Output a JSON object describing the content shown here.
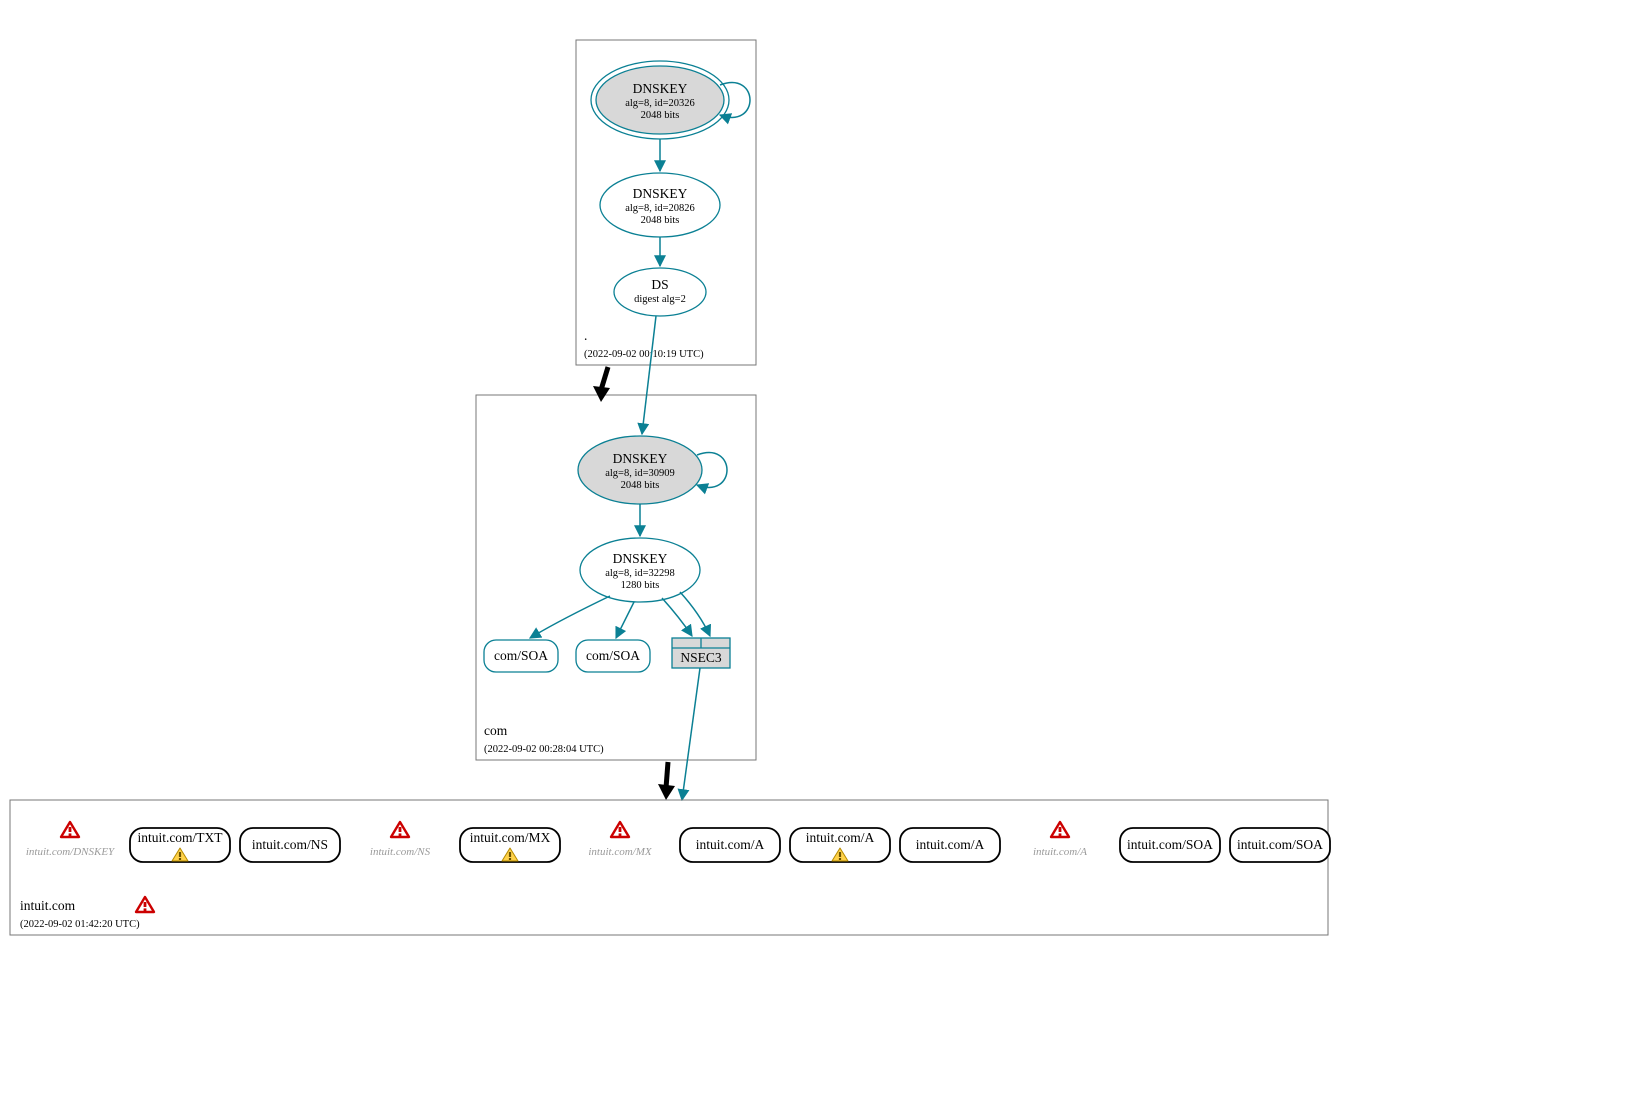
{
  "zones": {
    "root": {
      "label": ".",
      "timestamp": "(2022-09-02 00:10:19 UTC)"
    },
    "com": {
      "label": "com",
      "timestamp": "(2022-09-02 00:28:04 UTC)"
    },
    "intuit": {
      "label": "intuit.com",
      "timestamp": "(2022-09-02 01:42:20 UTC)"
    }
  },
  "nodes": {
    "root_ksk": {
      "title": "DNSKEY",
      "l2": "alg=8, id=20326",
      "l3": "2048 bits"
    },
    "root_zsk": {
      "title": "DNSKEY",
      "l2": "alg=8, id=20826",
      "l3": "2048 bits"
    },
    "root_ds": {
      "title": "DS",
      "l2": "digest alg=2"
    },
    "com_ksk": {
      "title": "DNSKEY",
      "l2": "alg=8, id=30909",
      "l3": "2048 bits"
    },
    "com_zsk": {
      "title": "DNSKEY",
      "l2": "alg=8, id=32298",
      "l3": "1280 bits"
    },
    "com_soa1": {
      "title": "com/SOA"
    },
    "com_soa2": {
      "title": "com/SOA"
    },
    "com_nsec3": {
      "title": "NSEC3"
    }
  },
  "intuit_row": [
    {
      "kind": "err-grey",
      "label": "intuit.com/DNSKEY"
    },
    {
      "kind": "pill-warn",
      "label": "intuit.com/TXT"
    },
    {
      "kind": "pill",
      "label": "intuit.com/NS"
    },
    {
      "kind": "err-grey",
      "label": "intuit.com/NS"
    },
    {
      "kind": "pill-warn",
      "label": "intuit.com/MX"
    },
    {
      "kind": "err-grey",
      "label": "intuit.com/MX"
    },
    {
      "kind": "pill",
      "label": "intuit.com/A"
    },
    {
      "kind": "pill-warn",
      "label": "intuit.com/A"
    },
    {
      "kind": "pill",
      "label": "intuit.com/A"
    },
    {
      "kind": "err-grey",
      "label": "intuit.com/A"
    },
    {
      "kind": "pill",
      "label": "intuit.com/SOA"
    },
    {
      "kind": "pill",
      "label": "intuit.com/SOA"
    }
  ]
}
